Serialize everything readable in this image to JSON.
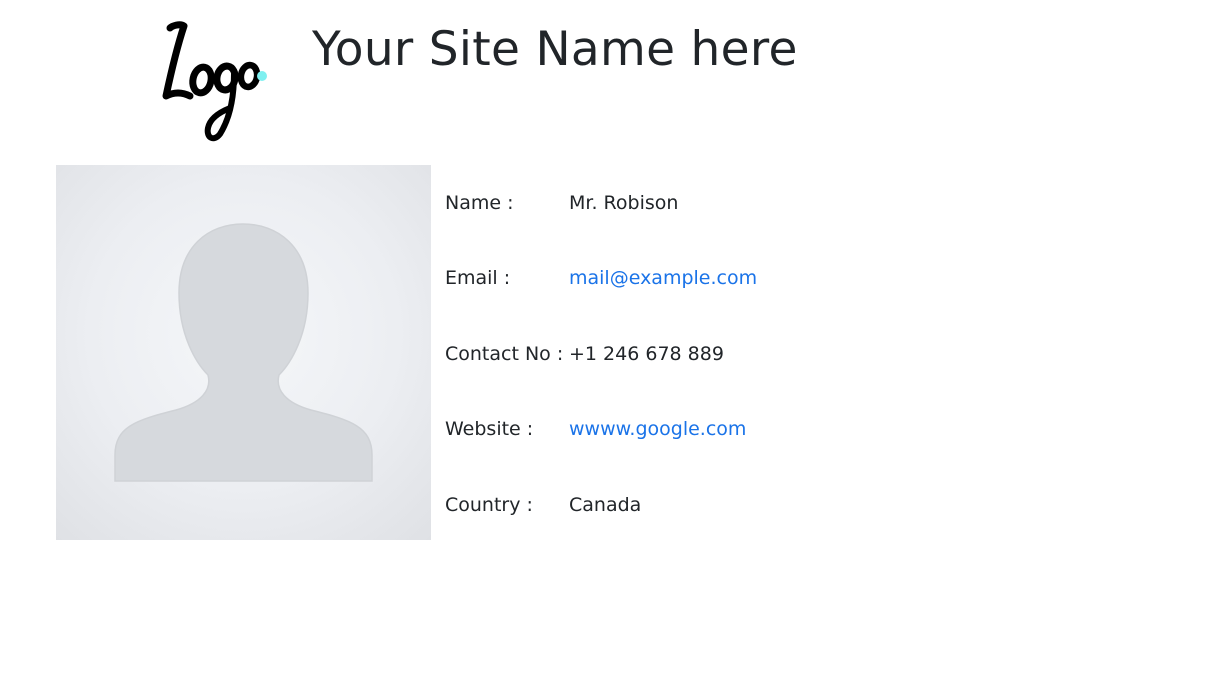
{
  "header": {
    "logo_text": "Logo",
    "site_name": "Your Site Name here"
  },
  "colors": {
    "link": "#1a73e8",
    "logo_dot": "#7ff0f0",
    "text": "#212529"
  },
  "profile": {
    "avatar_icon": "user-silhouette-icon",
    "name_label": "Name :",
    "name_value": "Mr. Robison",
    "email_label": "Email :",
    "email_value": "mail@example.com",
    "contact_label": "Contact No :",
    "contact_value": "+1 246 678 889",
    "website_label": "Website :",
    "website_value": "wwww.google.com",
    "country_label": "Country :",
    "country_value": "Canada"
  }
}
